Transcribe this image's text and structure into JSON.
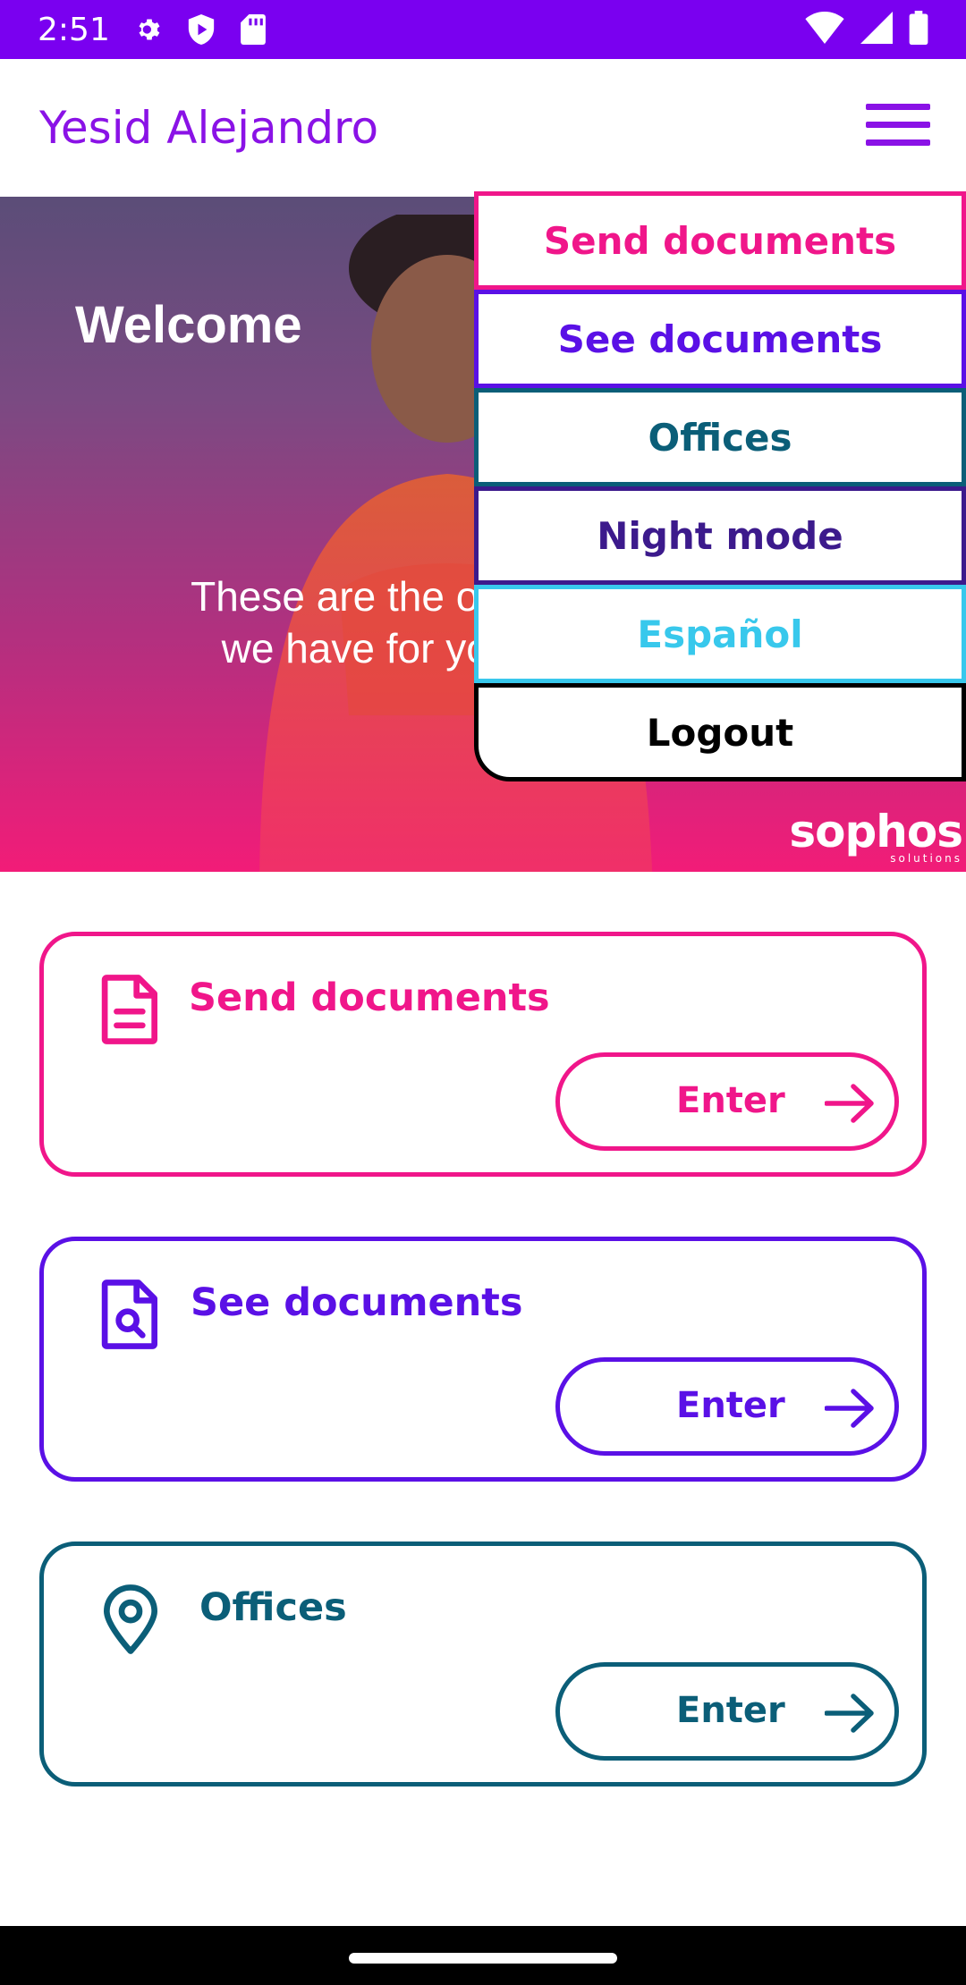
{
  "status_bar": {
    "time": "2:51",
    "icons": [
      "gear-icon",
      "shield-play-icon",
      "sd-card-icon",
      "wifi-icon",
      "signal-icon",
      "battery-icon"
    ]
  },
  "app_bar": {
    "title": "Yesid Alejandro",
    "menu_icon": "hamburger-menu-icon"
  },
  "hero": {
    "welcome": "Welcome",
    "subtitle_line1": "These are the optic",
    "subtitle_line2": "we have for you",
    "logo": "sophos",
    "logo_sub": "solutions"
  },
  "menu": {
    "items": [
      {
        "label": "Send documents",
        "color": "#f0168a"
      },
      {
        "label": "See documents",
        "color": "#5a10e6"
      },
      {
        "label": "Offices",
        "color": "#0b5e78"
      },
      {
        "label": "Night mode",
        "color": "#3c1a8c"
      },
      {
        "label": "Español",
        "color": "#38c8ec"
      },
      {
        "label": "Logout",
        "color": "#000000"
      }
    ]
  },
  "cards": [
    {
      "title": "Send documents",
      "button": "Enter",
      "icon": "document-icon",
      "color": "#f0168a"
    },
    {
      "title": "See documents",
      "button": "Enter",
      "icon": "document-search-icon",
      "color": "#5a10e6"
    },
    {
      "title": "Offices",
      "button": "Enter",
      "icon": "location-pin-icon",
      "color": "#0b5e78"
    }
  ],
  "colors": {
    "status_bar": "#7a00f0",
    "app_title": "#8a12e6"
  }
}
